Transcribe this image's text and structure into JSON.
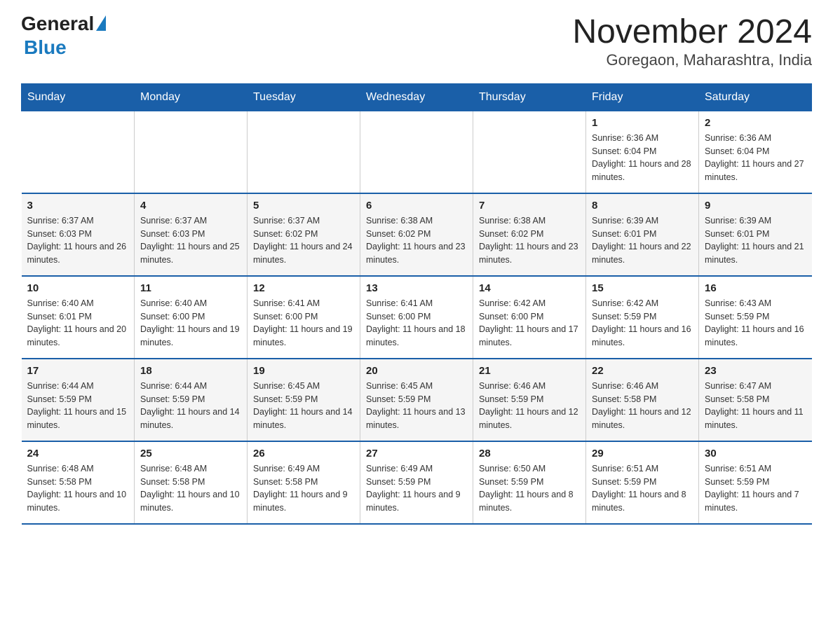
{
  "logo": {
    "general": "General",
    "blue": "Blue"
  },
  "title": "November 2024",
  "subtitle": "Goregaon, Maharashtra, India",
  "days_header": [
    "Sunday",
    "Monday",
    "Tuesday",
    "Wednesday",
    "Thursday",
    "Friday",
    "Saturday"
  ],
  "weeks": [
    [
      {
        "num": "",
        "sunrise": "",
        "sunset": "",
        "daylight": ""
      },
      {
        "num": "",
        "sunrise": "",
        "sunset": "",
        "daylight": ""
      },
      {
        "num": "",
        "sunrise": "",
        "sunset": "",
        "daylight": ""
      },
      {
        "num": "",
        "sunrise": "",
        "sunset": "",
        "daylight": ""
      },
      {
        "num": "",
        "sunrise": "",
        "sunset": "",
        "daylight": ""
      },
      {
        "num": "1",
        "sunrise": "Sunrise: 6:36 AM",
        "sunset": "Sunset: 6:04 PM",
        "daylight": "Daylight: 11 hours and 28 minutes."
      },
      {
        "num": "2",
        "sunrise": "Sunrise: 6:36 AM",
        "sunset": "Sunset: 6:04 PM",
        "daylight": "Daylight: 11 hours and 27 minutes."
      }
    ],
    [
      {
        "num": "3",
        "sunrise": "Sunrise: 6:37 AM",
        "sunset": "Sunset: 6:03 PM",
        "daylight": "Daylight: 11 hours and 26 minutes."
      },
      {
        "num": "4",
        "sunrise": "Sunrise: 6:37 AM",
        "sunset": "Sunset: 6:03 PM",
        "daylight": "Daylight: 11 hours and 25 minutes."
      },
      {
        "num": "5",
        "sunrise": "Sunrise: 6:37 AM",
        "sunset": "Sunset: 6:02 PM",
        "daylight": "Daylight: 11 hours and 24 minutes."
      },
      {
        "num": "6",
        "sunrise": "Sunrise: 6:38 AM",
        "sunset": "Sunset: 6:02 PM",
        "daylight": "Daylight: 11 hours and 23 minutes."
      },
      {
        "num": "7",
        "sunrise": "Sunrise: 6:38 AM",
        "sunset": "Sunset: 6:02 PM",
        "daylight": "Daylight: 11 hours and 23 minutes."
      },
      {
        "num": "8",
        "sunrise": "Sunrise: 6:39 AM",
        "sunset": "Sunset: 6:01 PM",
        "daylight": "Daylight: 11 hours and 22 minutes."
      },
      {
        "num": "9",
        "sunrise": "Sunrise: 6:39 AM",
        "sunset": "Sunset: 6:01 PM",
        "daylight": "Daylight: 11 hours and 21 minutes."
      }
    ],
    [
      {
        "num": "10",
        "sunrise": "Sunrise: 6:40 AM",
        "sunset": "Sunset: 6:01 PM",
        "daylight": "Daylight: 11 hours and 20 minutes."
      },
      {
        "num": "11",
        "sunrise": "Sunrise: 6:40 AM",
        "sunset": "Sunset: 6:00 PM",
        "daylight": "Daylight: 11 hours and 19 minutes."
      },
      {
        "num": "12",
        "sunrise": "Sunrise: 6:41 AM",
        "sunset": "Sunset: 6:00 PM",
        "daylight": "Daylight: 11 hours and 19 minutes."
      },
      {
        "num": "13",
        "sunrise": "Sunrise: 6:41 AM",
        "sunset": "Sunset: 6:00 PM",
        "daylight": "Daylight: 11 hours and 18 minutes."
      },
      {
        "num": "14",
        "sunrise": "Sunrise: 6:42 AM",
        "sunset": "Sunset: 6:00 PM",
        "daylight": "Daylight: 11 hours and 17 minutes."
      },
      {
        "num": "15",
        "sunrise": "Sunrise: 6:42 AM",
        "sunset": "Sunset: 5:59 PM",
        "daylight": "Daylight: 11 hours and 16 minutes."
      },
      {
        "num": "16",
        "sunrise": "Sunrise: 6:43 AM",
        "sunset": "Sunset: 5:59 PM",
        "daylight": "Daylight: 11 hours and 16 minutes."
      }
    ],
    [
      {
        "num": "17",
        "sunrise": "Sunrise: 6:44 AM",
        "sunset": "Sunset: 5:59 PM",
        "daylight": "Daylight: 11 hours and 15 minutes."
      },
      {
        "num": "18",
        "sunrise": "Sunrise: 6:44 AM",
        "sunset": "Sunset: 5:59 PM",
        "daylight": "Daylight: 11 hours and 14 minutes."
      },
      {
        "num": "19",
        "sunrise": "Sunrise: 6:45 AM",
        "sunset": "Sunset: 5:59 PM",
        "daylight": "Daylight: 11 hours and 14 minutes."
      },
      {
        "num": "20",
        "sunrise": "Sunrise: 6:45 AM",
        "sunset": "Sunset: 5:59 PM",
        "daylight": "Daylight: 11 hours and 13 minutes."
      },
      {
        "num": "21",
        "sunrise": "Sunrise: 6:46 AM",
        "sunset": "Sunset: 5:59 PM",
        "daylight": "Daylight: 11 hours and 12 minutes."
      },
      {
        "num": "22",
        "sunrise": "Sunrise: 6:46 AM",
        "sunset": "Sunset: 5:58 PM",
        "daylight": "Daylight: 11 hours and 12 minutes."
      },
      {
        "num": "23",
        "sunrise": "Sunrise: 6:47 AM",
        "sunset": "Sunset: 5:58 PM",
        "daylight": "Daylight: 11 hours and 11 minutes."
      }
    ],
    [
      {
        "num": "24",
        "sunrise": "Sunrise: 6:48 AM",
        "sunset": "Sunset: 5:58 PM",
        "daylight": "Daylight: 11 hours and 10 minutes."
      },
      {
        "num": "25",
        "sunrise": "Sunrise: 6:48 AM",
        "sunset": "Sunset: 5:58 PM",
        "daylight": "Daylight: 11 hours and 10 minutes."
      },
      {
        "num": "26",
        "sunrise": "Sunrise: 6:49 AM",
        "sunset": "Sunset: 5:58 PM",
        "daylight": "Daylight: 11 hours and 9 minutes."
      },
      {
        "num": "27",
        "sunrise": "Sunrise: 6:49 AM",
        "sunset": "Sunset: 5:59 PM",
        "daylight": "Daylight: 11 hours and 9 minutes."
      },
      {
        "num": "28",
        "sunrise": "Sunrise: 6:50 AM",
        "sunset": "Sunset: 5:59 PM",
        "daylight": "Daylight: 11 hours and 8 minutes."
      },
      {
        "num": "29",
        "sunrise": "Sunrise: 6:51 AM",
        "sunset": "Sunset: 5:59 PM",
        "daylight": "Daylight: 11 hours and 8 minutes."
      },
      {
        "num": "30",
        "sunrise": "Sunrise: 6:51 AM",
        "sunset": "Sunset: 5:59 PM",
        "daylight": "Daylight: 11 hours and 7 minutes."
      }
    ]
  ]
}
